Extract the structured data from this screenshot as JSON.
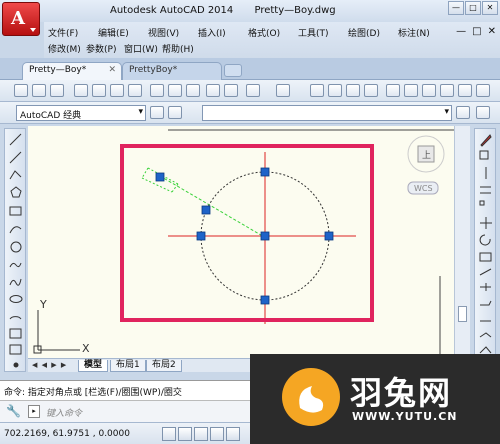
{
  "title": {
    "app": "Autodesk AutoCAD 2014",
    "file": "Pretty—Boy.dwg"
  },
  "app_menu_letter": "A",
  "window_buttons": [
    "—",
    "□",
    "✕"
  ],
  "inner_buttons": [
    "—",
    "□",
    "✕"
  ],
  "menu": {
    "row1": [
      "文件(F)",
      "编辑(E)",
      "视图(V)",
      "插入(I)",
      "格式(O)",
      "工具(T)",
      "绘图(D)",
      "标注(N)"
    ],
    "row2": [
      "修改(M)",
      "参数(P)",
      "窗口(W)",
      "帮助(H)"
    ]
  },
  "doc_tabs": [
    {
      "label": "Pretty—Boy*",
      "close": "✕"
    },
    {
      "label": "PrettyBoy*"
    }
  ],
  "workspace": "AutoCAD 经典",
  "canvas": {
    "view_cube_top": "上",
    "wcs": "WCS",
    "axis_x": "X",
    "axis_y": "Y"
  },
  "layout_tabs": [
    "模型",
    "布局1",
    "布局2"
  ],
  "nav_arrows": "◀ ◀ ▶ ▶",
  "command": {
    "history": "命令: 指定对角点或 [栏选(F)/圈围(WP)/圈交",
    "placeholder": "键入命令",
    "prompt_glyph": "▸"
  },
  "status": {
    "coordinates": "702.2169, 61.9751 , 0.0000"
  },
  "brand": {
    "name": "羽兔网",
    "url": "WWW.YUTU.CN"
  },
  "colors": {
    "highlight_box": "#e0245e",
    "grip": "#1e63c8",
    "centerline": "#d22",
    "brand_bg": "#2b2b2b",
    "brand_logo": "#f5a623"
  }
}
